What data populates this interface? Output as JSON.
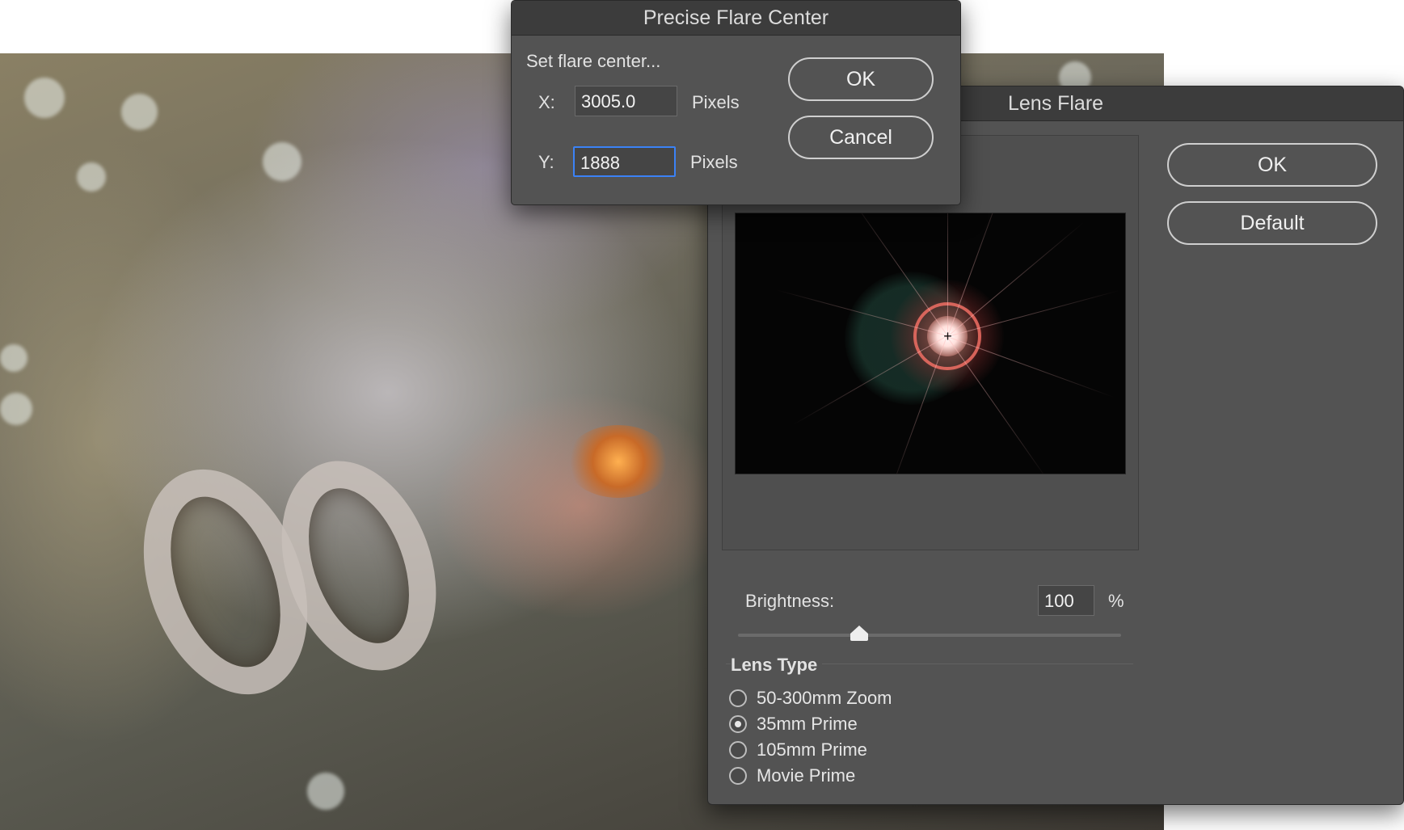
{
  "precise_flare_center": {
    "title": "Precise Flare Center",
    "prompt": "Set flare center...",
    "x_label": "X:",
    "x_value": "3005.0",
    "x_unit": "Pixels",
    "y_label": "Y:",
    "y_value": "1888",
    "y_unit": "Pixels",
    "ok_label": "OK",
    "cancel_label": "Cancel"
  },
  "lens_flare": {
    "title": "Lens Flare",
    "ok_label": "OK",
    "default_label": "Default",
    "brightness_label": "Brightness:",
    "brightness_value": "100",
    "brightness_unit": "%",
    "brightness_slider_fraction": 0.3,
    "lens_type_label": "Lens Type",
    "lens_types": [
      {
        "label": "50-300mm Zoom",
        "selected": false
      },
      {
        "label": "35mm Prime",
        "selected": true
      },
      {
        "label": "105mm Prime",
        "selected": false
      },
      {
        "label": "Movie Prime",
        "selected": false
      }
    ]
  },
  "colors": {
    "dialog_bg": "#535353",
    "titlebar_bg": "#3c3c3c",
    "focus_ring": "#3b82f6"
  }
}
